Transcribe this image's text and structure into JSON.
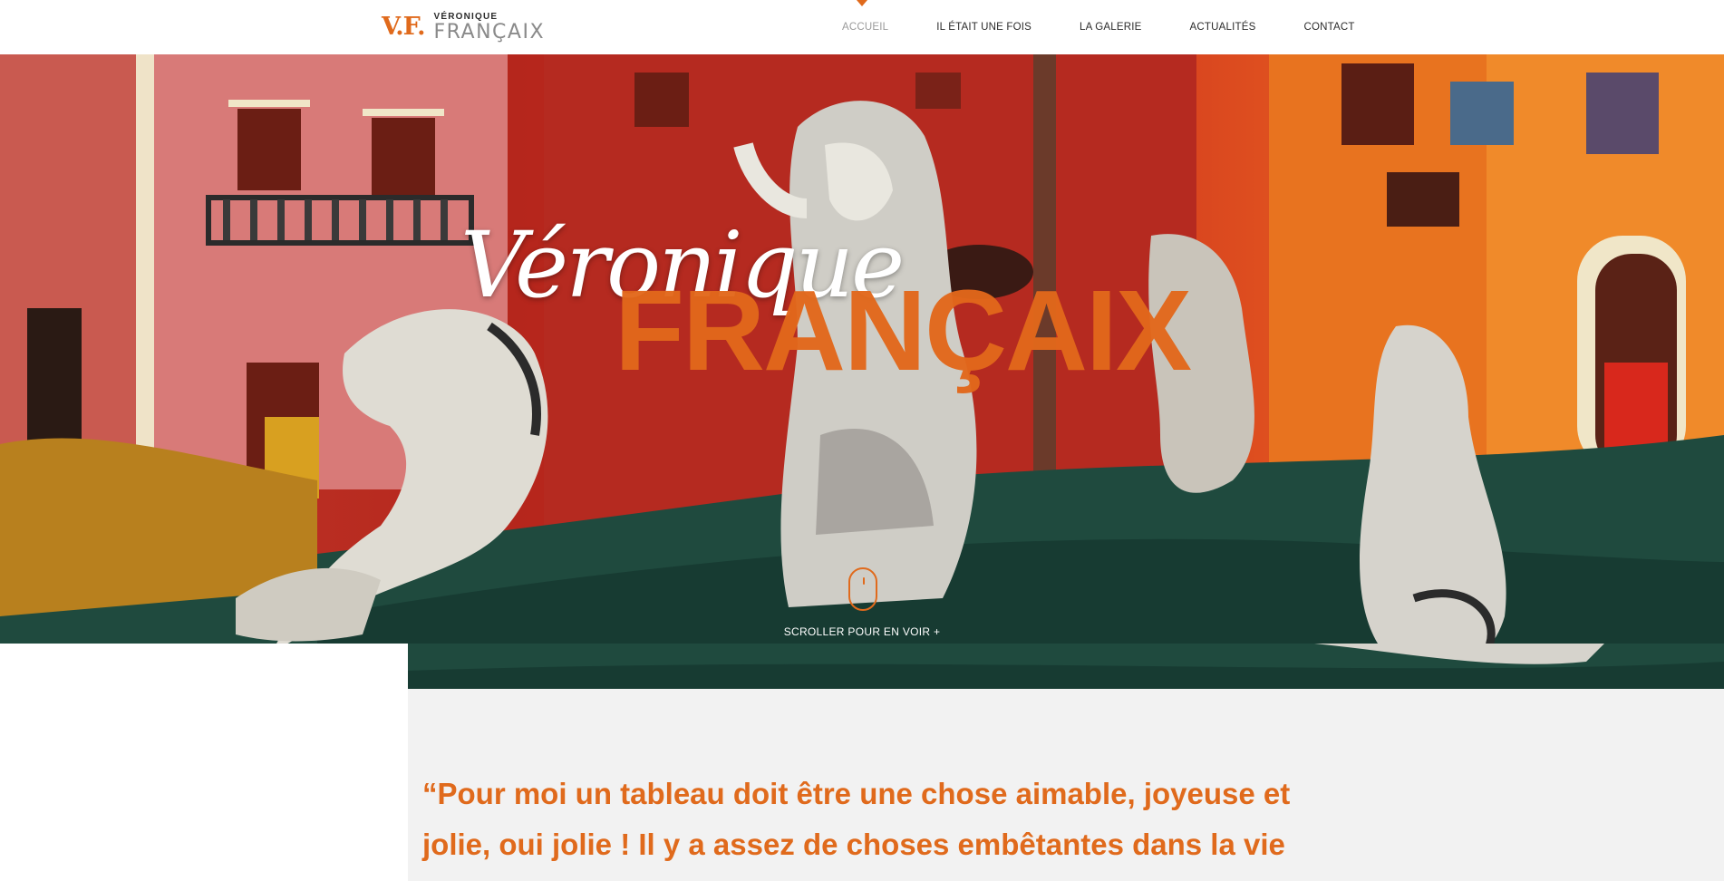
{
  "header": {
    "logo": {
      "mark": "V.F.",
      "first_name": "VÉRONIQUE",
      "last_name": "FRANÇAIX"
    },
    "nav": [
      {
        "label": "ACCUEIL",
        "active": true
      },
      {
        "label": "IL ÉTAIT UNE FOIS",
        "active": false
      },
      {
        "label": "LA GALERIE",
        "active": false
      },
      {
        "label": "ACTUALITÉS",
        "active": false
      },
      {
        "label": "CONTACT",
        "active": false
      }
    ]
  },
  "hero": {
    "title_first": "Véronique",
    "title_last": "FRANÇAIX",
    "scroll_hint": "SCROLLER POUR EN VOIR +"
  },
  "content": {
    "quote": "“Pour moi un tableau doit être une chose aimable, joyeuse et jolie, oui jolie ! Il y a assez de choses embêtantes dans la vie"
  },
  "colors": {
    "accent": "#e06a1c",
    "panel": "#f2f2f2",
    "text": "#2b2b2b"
  }
}
